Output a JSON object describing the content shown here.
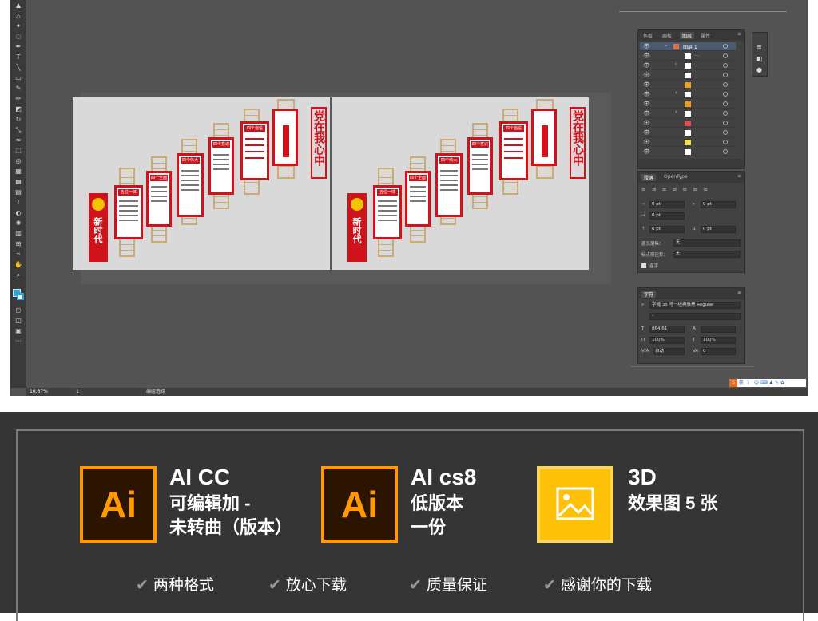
{
  "statusbar": {
    "zoom": "16.67%",
    "page": "1",
    "tool_hint": "编组选择"
  },
  "layers_panel": {
    "tabs": [
      "色板",
      "画板",
      "图层",
      "属性"
    ],
    "active_tab": "图层",
    "top_layer_name": "图层 1"
  },
  "paragraph_panel": {
    "tabs": [
      "段落",
      "OpenType"
    ],
    "indent_left": "0 pt",
    "indent_right": "0 pt",
    "first_indent": "0 pt",
    "space_before": "0 pt",
    "space_after": "0 pt",
    "kinsoku_label": "避头尾集：",
    "kinsoku_value": "无",
    "mojikumi_label": "标点挤压集：",
    "mojikumi_value": "无",
    "hyphenate_label": "连字"
  },
  "character_panel": {
    "title": "字符",
    "font": "字魂 35 号－经典雅黑 Regular",
    "style": "-",
    "font_size": "864.61",
    "scale_v": "100%",
    "scale_h": "100%",
    "tracking": "自动",
    "kerning": "0"
  },
  "artwork": {
    "title_big": "党在我心中",
    "side_title": "新时代",
    "panel_heads": [
      "五位一体",
      "四个全面",
      "四个伟大",
      "四个意识",
      "四个自信"
    ]
  },
  "promo": {
    "ai_icon": "Ai",
    "item1_title": "AI CC",
    "item1_line2": "可编辑加 -",
    "item1_line3": "未转曲（版本）",
    "item2_title": "AI cs8",
    "item2_line2": "低版本",
    "item2_line3": "一份",
    "item3_title": "3D",
    "item3_line2": "效果图 5 张",
    "features": [
      "两种格式",
      "放心下载",
      "质量保证",
      "感谢你的下载"
    ]
  },
  "colors": {
    "brand_red": "#d0121b",
    "ai_orange": "#ff9a00",
    "image_yellow": "#ffc107"
  }
}
